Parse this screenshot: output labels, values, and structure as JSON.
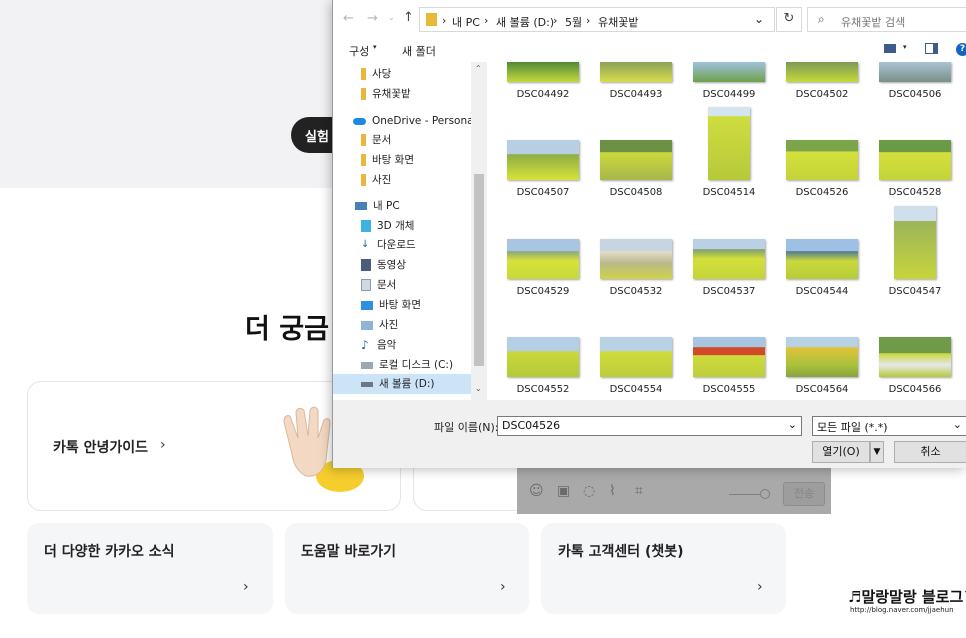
{
  "background": {
    "experiment_pill": "실험",
    "heading": "더 궁금",
    "card_guide": "카톡 안녕가이드",
    "card_news": "더 다양한 카카오 소식",
    "card_help": "도움말 바로가기",
    "card_center": "카톡 고객센터 (챗봇)",
    "send_label": "전송"
  },
  "dialog": {
    "breadcrumb": [
      "내 PC",
      "새 볼륨 (D:)",
      "5월",
      "유채꽃밭"
    ],
    "search_placeholder": "유채꽃밭 검색",
    "toolbar": {
      "organize": "구성",
      "new_folder": "새 폴더"
    },
    "nav_items": [
      "사당",
      "유채꽃밭",
      "OneDrive - Personal",
      "문서",
      "바탕 화면",
      "사진",
      "내 PC",
      "3D 개체",
      "다운로드",
      "동영상",
      "문서",
      "바탕 화면",
      "사진",
      "음악",
      "로컬 디스크 (C:)",
      "새 볼륨 (D:)"
    ],
    "files": [
      "DSC04492",
      "DSC04493",
      "DSC04499",
      "DSC04502",
      "DSC04506",
      "DSC04507",
      "DSC04508",
      "DSC04514",
      "DSC04526",
      "DSC04528",
      "DSC04529",
      "DSC04532",
      "DSC04537",
      "DSC04544",
      "DSC04547",
      "DSC04552",
      "DSC04554",
      "DSC04555",
      "DSC04564",
      "DSC04566"
    ],
    "filename_label": "파일 이름(N):",
    "filename_value": "DSC04526",
    "filetype_value": "모든 파일 (*.*)",
    "open_label": "열기(O)",
    "cancel_label": "취소"
  },
  "watermark": {
    "title": "♬말랑말랑 블로그™",
    "url": "http://blog.naver.com/jjaehun"
  },
  "colors": {
    "accent": "#0a60c2",
    "folder": "#e8b83a",
    "field": "#c6d93a"
  }
}
